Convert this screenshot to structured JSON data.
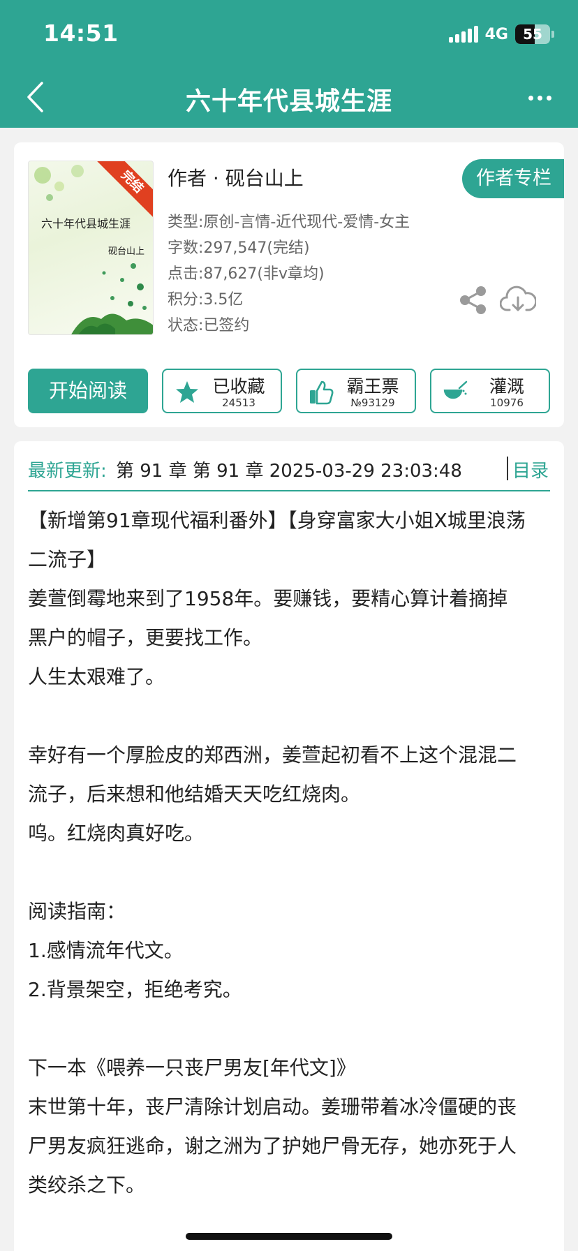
{
  "status_bar": {
    "time": "14:51",
    "network": "4G",
    "battery": "55"
  },
  "nav": {
    "title": "六十年代县城生涯"
  },
  "book": {
    "cover_title": "六十年代县城生涯",
    "cover_author": "砚台山上",
    "cover_badge": "完结",
    "author_line": "作者 · 砚台山上",
    "author_column_label": "作者专栏",
    "meta": [
      "类型:原创-言情-近代现代-爱情-女主",
      "字数:297,547(完结)",
      "点击:87,627(非v章均)",
      "积分:3.5亿",
      "状态:已签约"
    ]
  },
  "actions": {
    "read_label": "开始阅读",
    "collect": {
      "label": "已收藏",
      "count": "24513"
    },
    "vote": {
      "label": "霸王票",
      "count": "№93129"
    },
    "water": {
      "label": "灌溉",
      "count": "10976"
    }
  },
  "latest": {
    "label": "最新更新:",
    "text": "第 91 章 第 91 章 2025-03-29 23:03:48",
    "toc_label": "目录"
  },
  "intro": [
    "【新增第91章现代福利番外】【身穿富家大小姐X城里浪荡",
    "二流子】",
    "姜萱倒霉地来到了1958年。要赚钱，要精心算计着摘掉",
    "黑户的帽子，更要找工作。",
    "人生太艰难了。",
    "",
    "幸好有一个厚脸皮的郑西洲，姜萱起初看不上这个混混二",
    "流子，后来想和他结婚天天吃红烧肉。",
    "呜。红烧肉真好吃。",
    "",
    "阅读指南：",
    "1.感情流年代文。",
    "2.背景架空，拒绝考究。",
    "",
    "下一本《喂养一只丧尸男友[年代文]》",
    "末世第十年，丧尸清除计划启动。姜珊带着冰冷僵硬的丧",
    "尸男友疯狂逃命，谢之洲为了护她尸骨无存，她亦死于人",
    "类绞杀之下。"
  ],
  "colors": {
    "accent": "#2ea593",
    "badge": "#e04020"
  }
}
